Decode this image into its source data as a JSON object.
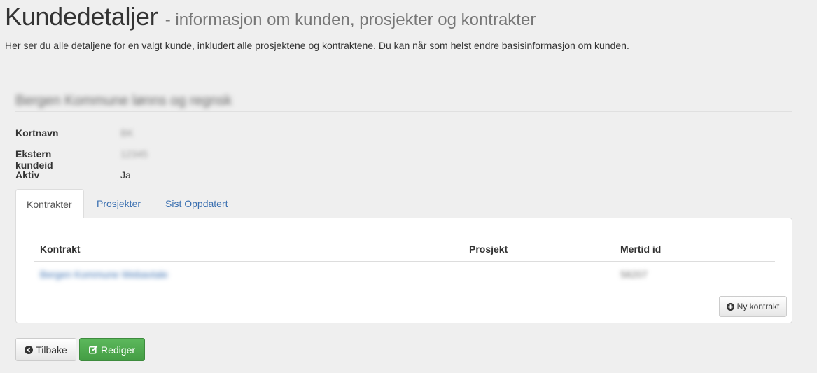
{
  "header": {
    "title": "Kundedetaljer",
    "subtitle": "- informasjon om kunden, prosjekter og kontrakter",
    "description": "Her ser du alle detaljene for en valgt kunde, inkludert alle prosjektene og kontraktene. Du kan når som helst endre basisinformasjon om kunden."
  },
  "customer": {
    "name": "Bergen Kommune lønns og regnsk",
    "details": [
      {
        "label": "Kortnavn",
        "value": "BK"
      },
      {
        "label": "Ekstern kundeid",
        "value": "12345"
      },
      {
        "label": "Aktiv",
        "value": "Ja"
      }
    ]
  },
  "tabs": [
    {
      "label": "Kontrakter",
      "active": true
    },
    {
      "label": "Prosjekter",
      "active": false
    },
    {
      "label": "Sist Oppdatert",
      "active": false
    }
  ],
  "contracts_table": {
    "columns": [
      "Kontrakt",
      "Prosjekt",
      "Mertid id"
    ],
    "rows": [
      {
        "kontrakt": "Bergen Kommune Webavtale",
        "prosjekt": "",
        "mertid_id": "58207"
      }
    ],
    "new_button_label": "Ny kontrakt"
  },
  "actions": {
    "back_label": "Tilbake",
    "edit_label": "Rediger"
  },
  "colors": {
    "link": "#3a6fb0",
    "success": "#5cb85c",
    "background": "#efefef"
  }
}
